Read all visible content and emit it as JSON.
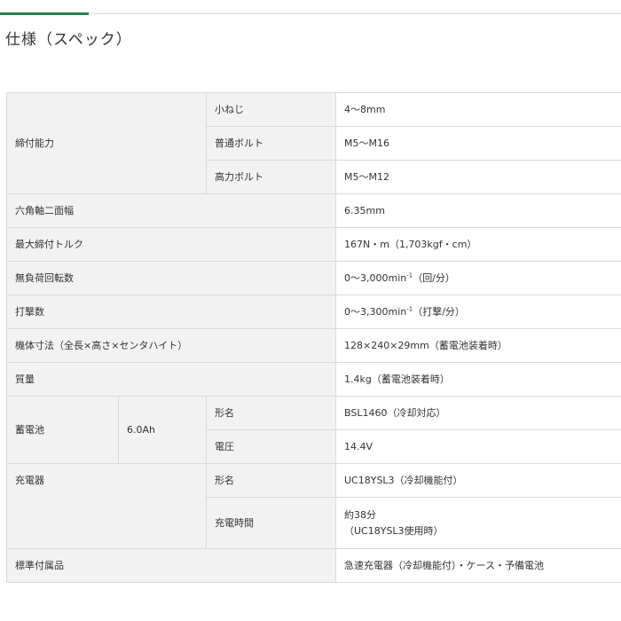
{
  "page": {
    "title": "仕様（スペック）",
    "accent_color": "#2e7d4f"
  },
  "specs": {
    "fastening_capacity": {
      "label": "締付能力",
      "small_screw": {
        "label": "小ねじ",
        "value": "4～8mm"
      },
      "normal_bolt": {
        "label": "普通ボルト",
        "value": "M5～M16"
      },
      "high_tension_bolt": {
        "label": "高力ボルト",
        "value": "M5～M12"
      }
    },
    "hex_shank": {
      "label": "六角軸二面幅",
      "value": "6.35mm"
    },
    "max_torque": {
      "label": "最大締付トルク",
      "value": "167N・m（1,703kgf・cm）"
    },
    "no_load_speed": {
      "label": "無負荷回転数",
      "value_main": "0～3,000min",
      "value_sup": "-1",
      "value_unit": "（回/分）"
    },
    "impact_rate": {
      "label": "打撃数",
      "value_main": "0～3,300min",
      "value_sup": "-1",
      "value_unit": "（打撃/分）"
    },
    "dimensions": {
      "label": "機体寸法（全長×高さ×センタハイト）",
      "value": "128×240×29mm（蓄電池装着時）"
    },
    "weight": {
      "label": "質量",
      "value": "1.4kg（蓄電池装着時）"
    },
    "battery": {
      "label": "蓄電池",
      "capacity": "6.0Ah",
      "model": {
        "label": "形名",
        "value": "BSL1460（冷却対応）"
      },
      "voltage": {
        "label": "電圧",
        "value": "14.4V"
      }
    },
    "charger": {
      "label": "充電器",
      "model": {
        "label": "形名",
        "value": "UC18YSL3（冷却機能付）"
      },
      "charge_time": {
        "label": "充電時間",
        "value_line1": "約38分",
        "value_line2": "（UC18YSL3使用時）"
      }
    },
    "accessories": {
      "label": "標準付属品",
      "value": "急速充電器（冷却機能付）・ケース・予備電池"
    }
  }
}
